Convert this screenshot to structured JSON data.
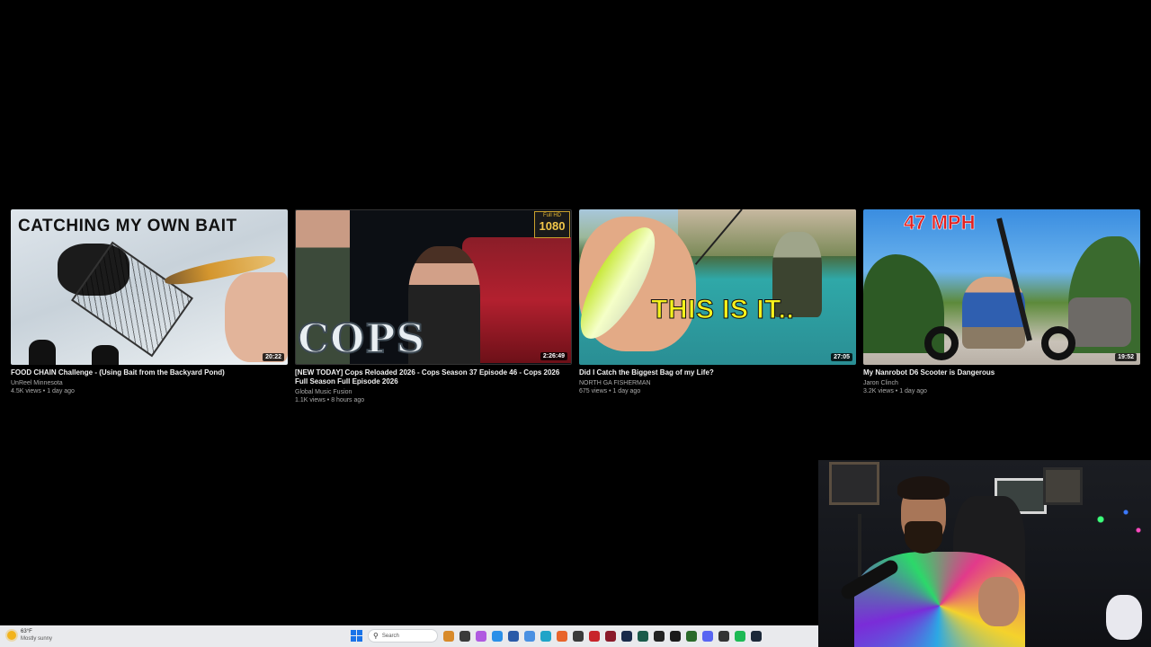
{
  "videos": [
    {
      "title": "FOOD CHAIN Challenge - (Using Bait from the Backyard Pond)",
      "channel": "UnReel Minnesota",
      "meta": "4.5K views • 1 day ago",
      "duration": "20:22",
      "thumb_text": "CATCHING MY OWN BAIT"
    },
    {
      "title": "[NEW TODAY] Cops Reloaded 2026 - Cops Season 37 Episode 46 - Cops 2026 Full Season Full Episode 2026",
      "channel": "Global Music Fusion",
      "meta": "1.1K views • 8 hours ago",
      "duration": "2:26:49",
      "thumb_text": "COPS",
      "badge_top": "Full HD",
      "badge_num": "1080"
    },
    {
      "title": "Did I Catch the Biggest Bag of my Life?",
      "channel": "NORTH GA FISHERMAN",
      "meta": "675 views • 1 day ago",
      "duration": "27:05",
      "thumb_text": "THIS IS IT.."
    },
    {
      "title": "My Nanrobot D6 Scooter is Dangerous",
      "channel": "Jaron Clinch",
      "meta": "3.2K views • 1 day ago",
      "duration": "19:52",
      "thumb_text": "47 MPH"
    }
  ],
  "taskbar": {
    "weather_temp": "63°F",
    "weather_cond": "Mostly sunny",
    "search_placeholder": "Search",
    "apps": [
      {
        "name": "pen-icon",
        "color": "#d88a2a"
      },
      {
        "name": "file-explorer-icon",
        "color": "#3a3a3a"
      },
      {
        "name": "copilot-icon",
        "color": "#b05ae0"
      },
      {
        "name": "gallery-icon",
        "color": "#2a8fe8"
      },
      {
        "name": "store-icon",
        "color": "#2a5aa8"
      },
      {
        "name": "photos-icon",
        "color": "#4a90e2"
      },
      {
        "name": "edge-icon",
        "color": "#1fa4c8"
      },
      {
        "name": "firefox-icon",
        "color": "#e8642a"
      },
      {
        "name": "app-icon",
        "color": "#3a3a3a"
      },
      {
        "name": "red-app-icon",
        "color": "#c8242a"
      },
      {
        "name": "dark-red-app-icon",
        "color": "#8a1a2a"
      },
      {
        "name": "c-app-icon",
        "color": "#1a2a4a"
      },
      {
        "name": "green-app-icon",
        "color": "#1a5a4a"
      },
      {
        "name": "d-app-icon",
        "color": "#222"
      },
      {
        "name": "terminal-icon",
        "color": "#1a1a1a"
      },
      {
        "name": "xbox-icon",
        "color": "#2a6a2a"
      },
      {
        "name": "discord-icon",
        "color": "#5865f2"
      },
      {
        "name": "obs-icon",
        "color": "#333"
      },
      {
        "name": "spotify-icon",
        "color": "#1db954"
      },
      {
        "name": "steam-icon",
        "color": "#1b2838"
      }
    ]
  }
}
